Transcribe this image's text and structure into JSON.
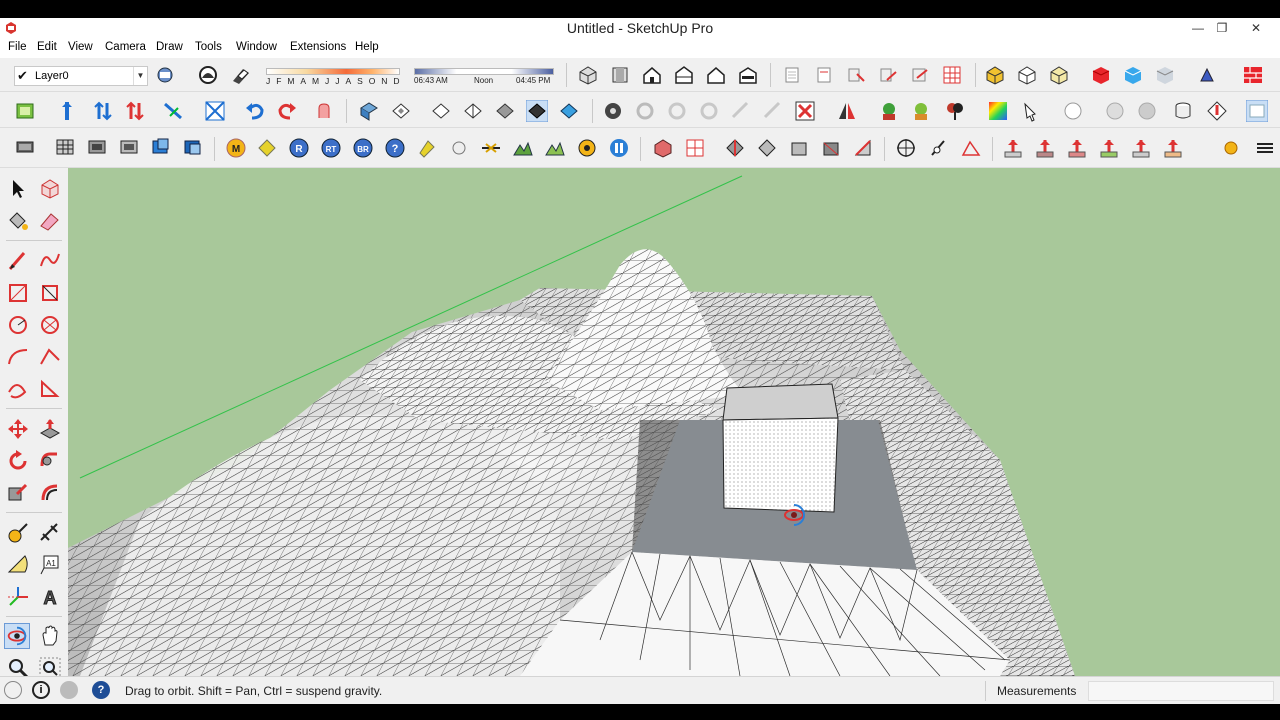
{
  "window": {
    "title": "Untitled - SketchUp Pro",
    "controls": [
      "minimize-icon",
      "restore-icon",
      "close-icon"
    ]
  },
  "menu": [
    "File",
    "Edit",
    "View",
    "Camera",
    "Draw",
    "Tools",
    "Window",
    "Extensions",
    "Help"
  ],
  "layer": {
    "check": "✔",
    "name": "Layer0"
  },
  "shadows": {
    "months": [
      "J",
      "F",
      "M",
      "A",
      "M",
      "J",
      "J",
      "A",
      "S",
      "O",
      "N",
      "D"
    ],
    "time_start": "06:43 AM",
    "time_noon": "Noon",
    "time_end": "04:45 PM"
  },
  "status": {
    "message": "Drag to orbit. Shift = Pan, Ctrl = suspend gravity.",
    "measurements_label": "Measurements",
    "measurements_value": ""
  },
  "colors": {
    "sky": "#a8c89a",
    "accent_red": "#e8252c",
    "accent_blue": "#2b7fd6",
    "ground": "#c8c8c8"
  }
}
